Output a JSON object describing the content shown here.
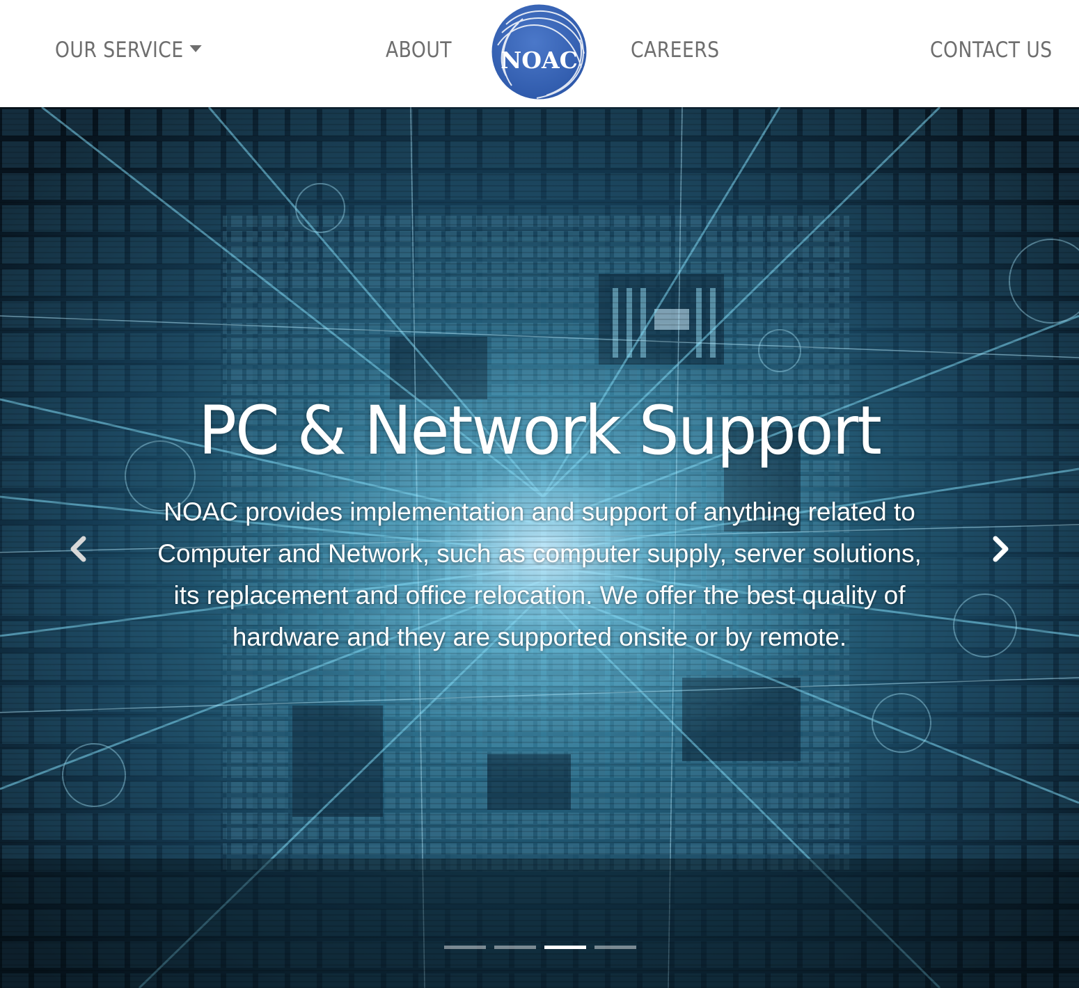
{
  "navbar": {
    "our_service": "OUR SERVICE",
    "about": "ABOUT",
    "careers": "CAREERS",
    "contact_us": "CONTACT US",
    "logo_text": "NOAC",
    "logo_color": "#3f6bbd"
  },
  "carousel": {
    "title": "PC & Network Support",
    "text": "NOAC provides implementation and support of anything related to Computer and Network, such as computer supply, server solutions, its replacement and office relocation. We offer the best quality of hardware and they are supported onsite or by remote.",
    "prev_icon": "chevron-left-icon",
    "next_icon": "chevron-right-icon",
    "slide_count": 4,
    "active_slide": 3
  },
  "colors": {
    "nav_text": "#6e6e6e",
    "hero_base": "#0a1e2c",
    "hero_accent": "#2aa0c8"
  }
}
